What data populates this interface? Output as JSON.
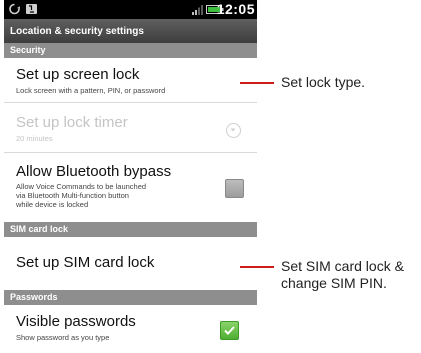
{
  "status_bar": {
    "time": "12:05",
    "icons": [
      "sync-icon",
      "notification-icon",
      "signal-icon",
      "battery-icon"
    ],
    "battery_color": "#3fbf3f"
  },
  "screen_title": "Location & security settings",
  "sections": {
    "security": "Security",
    "sim_card_lock": "SIM card lock",
    "passwords": "Passwords"
  },
  "items": {
    "screen_lock": {
      "title": "Set up screen lock",
      "subtitle": "Lock screen with a pattern, PIN, or password"
    },
    "lock_timer": {
      "title": "Set up lock timer",
      "subtitle": "20 minutes",
      "enabled": false
    },
    "bluetooth_bypass": {
      "title": "Allow Bluetooth bypass",
      "subtitle_lines": [
        "Allow Voice Commands to be launched",
        "via Bluetooth Multi-function button",
        "while device is locked"
      ],
      "checked": false
    },
    "sim_lock": {
      "title": "Set up SIM card lock"
    },
    "visible_passwords": {
      "title": "Visible passwords",
      "subtitle": "Show password as you type",
      "checked": true
    }
  },
  "callouts": {
    "lock_type": "Set lock type.",
    "sim_lines": [
      "Set SIM card lock &",
      "change SIM PIN."
    ]
  },
  "colors": {
    "callout_line": "#cc1b1b",
    "section_header": "#8e8e8e",
    "checkbox_on": "#4fae32"
  }
}
